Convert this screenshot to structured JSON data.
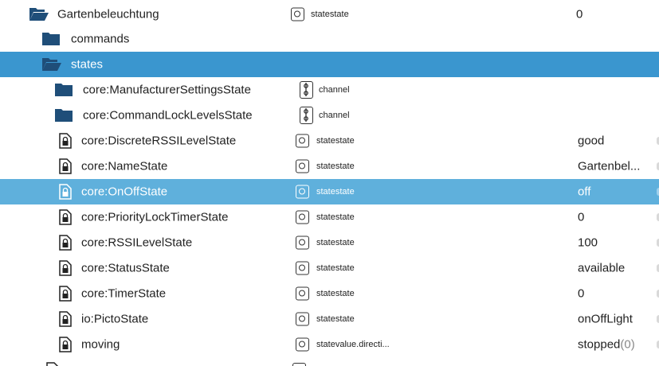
{
  "colors": {
    "folder": "#1f4e79",
    "selected_strong": "#3a96cf",
    "selected_light": "#5fb0dc"
  },
  "rows": [
    {
      "name": "Gartenbeleuchtung",
      "kind": "folder-open",
      "type": "statestate",
      "type_icon": "state-icon",
      "value": "0"
    },
    {
      "name": "commands",
      "kind": "folder-closed",
      "type": "",
      "value": ""
    },
    {
      "name": "states",
      "kind": "folder-open",
      "type": "",
      "value": ""
    },
    {
      "name": "core:ManufacturerSettingsState",
      "kind": "folder-closed",
      "type": "channel",
      "type_icon": "channel-icon",
      "value": ""
    },
    {
      "name": "core:CommandLockLevelsState",
      "kind": "folder-closed",
      "type": "channel",
      "type_icon": "channel-icon",
      "value": ""
    },
    {
      "name": "core:DiscreteRSSILevelState",
      "kind": "state-file",
      "type": "statestate",
      "type_icon": "state-icon",
      "value": "good"
    },
    {
      "name": "core:NameState",
      "kind": "state-file",
      "type": "statestate",
      "type_icon": "state-icon",
      "value": "Gartenbel..."
    },
    {
      "name": "core:OnOffState",
      "kind": "state-file",
      "type": "statestate",
      "type_icon": "state-icon",
      "value": "off"
    },
    {
      "name": "core:PriorityLockTimerState",
      "kind": "state-file",
      "type": "statestate",
      "type_icon": "state-icon",
      "value": "0"
    },
    {
      "name": "core:RSSILevelState",
      "kind": "state-file",
      "type": "statestate",
      "type_icon": "state-icon",
      "value": "100"
    },
    {
      "name": "core:StatusState",
      "kind": "state-file",
      "type": "statestate",
      "type_icon": "state-icon",
      "value": "available"
    },
    {
      "name": "core:TimerState",
      "kind": "state-file",
      "type": "statestate",
      "type_icon": "state-icon",
      "value": "0"
    },
    {
      "name": "io:PictoState",
      "kind": "state-file",
      "type": "statestate",
      "type_icon": "state-icon",
      "value": "onOffLight"
    },
    {
      "name": "moving",
      "kind": "state-file",
      "type": "statevalue.directi...",
      "type_icon": "state-icon",
      "value": "stopped",
      "value_ack": "(0)"
    }
  ]
}
